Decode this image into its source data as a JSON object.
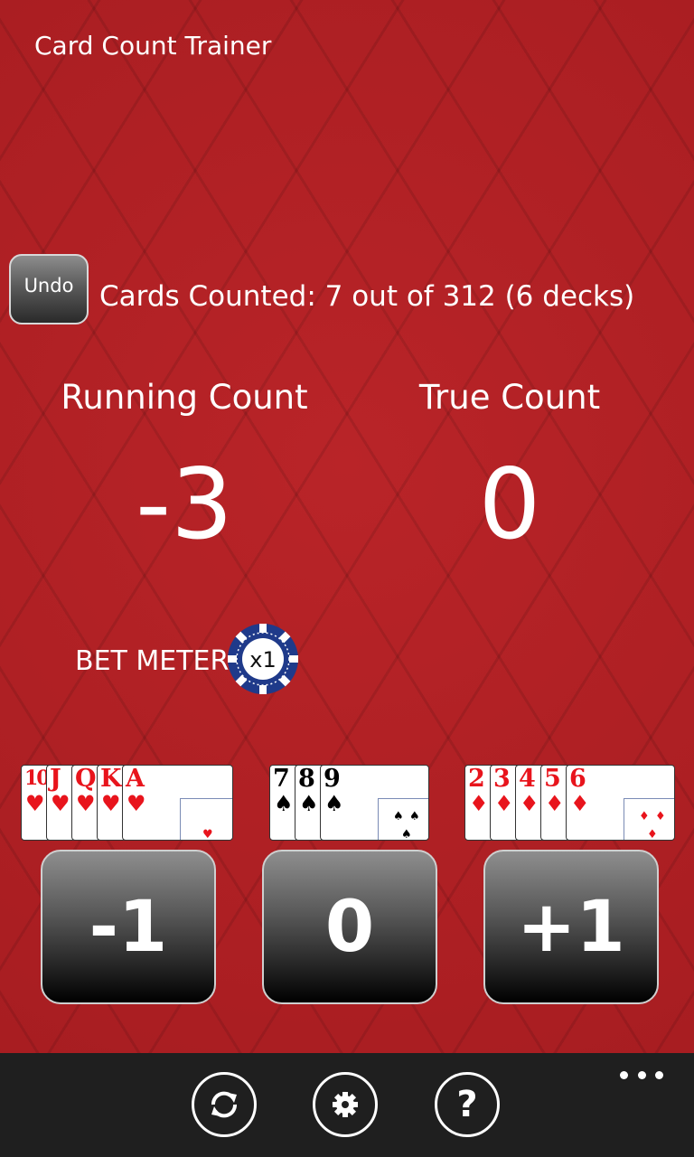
{
  "header": {
    "title": "Card Count Trainer"
  },
  "undo": {
    "label": "Undo"
  },
  "status": {
    "cards_counted": "Cards Counted: 7 out of 312 (6 decks)"
  },
  "running_count": {
    "label": "Running Count",
    "value": "-3"
  },
  "true_count": {
    "label": "True Count",
    "value": "0"
  },
  "bet_meter": {
    "label": "BET METER",
    "chip_text": "x1"
  },
  "card_groups": [
    {
      "ranks": [
        "10",
        "J",
        "Q",
        "K",
        "A"
      ],
      "suit": "♥",
      "color": "#e8141c"
    },
    {
      "ranks": [
        "7",
        "8",
        "9"
      ],
      "suit": "♠",
      "color": "#000000"
    },
    {
      "ranks": [
        "2",
        "3",
        "4",
        "5",
        "6"
      ],
      "suit": "♦",
      "color": "#e8141c"
    }
  ],
  "count_buttons": {
    "minus": "-1",
    "zero": "0",
    "plus": "+1"
  },
  "appbar": {
    "icons": [
      "refresh-icon",
      "settings-icon",
      "help-icon",
      "more-icon"
    ],
    "help_glyph": "?"
  },
  "colors": {
    "felt": "#b01e22",
    "appbar": "#1f1f1f",
    "chip": "#1f3a8a"
  }
}
